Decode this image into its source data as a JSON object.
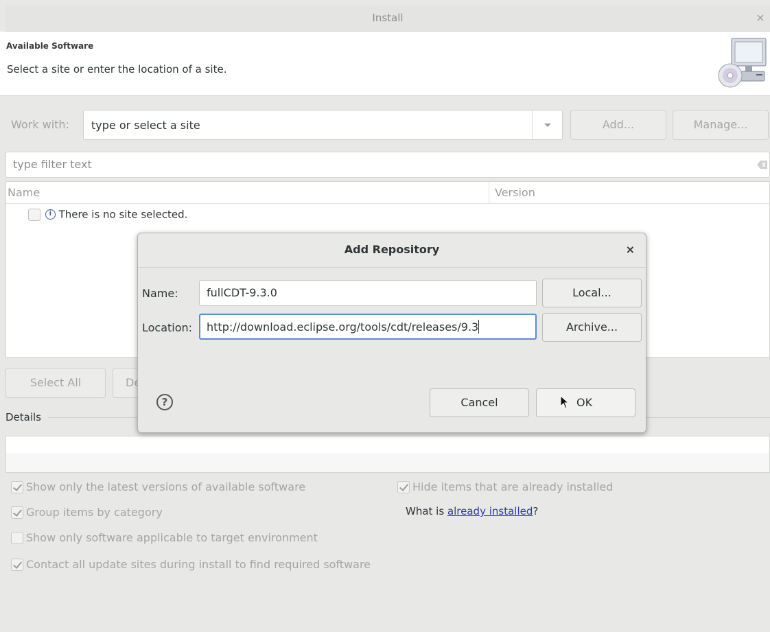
{
  "window": {
    "title": "Install",
    "close_glyph": "×"
  },
  "header": {
    "title": "Available Software",
    "description": "Select a site or enter the location of a site."
  },
  "work_with": {
    "label": "Work with:",
    "value": "type or select a site",
    "add_label": "Add...",
    "manage_label": "Manage..."
  },
  "filter": {
    "placeholder": "type filter text"
  },
  "table": {
    "columns": [
      "Name",
      "Version"
    ],
    "rows": [
      {
        "label": "There is no site selected."
      }
    ]
  },
  "buttons": {
    "select_all": "Select All",
    "deselect_all_partial": "De"
  },
  "details": {
    "label": "Details"
  },
  "options": {
    "latest_versions": {
      "label": "Show only the latest versions of available software",
      "checked": true
    },
    "group_by_category": {
      "label": "Group items by category",
      "checked": true
    },
    "applicable_only": {
      "label": "Show only software applicable to target environment",
      "checked": false
    },
    "contact_all_sites": {
      "label": "Contact all update sites during install to find required software",
      "checked": true
    },
    "hide_installed": {
      "label": "Hide items that are already installed",
      "checked": true
    },
    "what_is_prefix": "What is ",
    "already_installed_link": "already installed",
    "what_is_suffix": "?"
  },
  "dialog": {
    "title": "Add Repository",
    "close_glyph": "×",
    "name_label": "Name:",
    "name_value": "fullCDT-9.3.0",
    "location_label": "Location:",
    "location_value": "http://download.eclipse.org/tools/cdt/releases/9.3",
    "local_button": "Local...",
    "archive_button": "Archive...",
    "help_glyph": "?",
    "cancel_button": "Cancel",
    "ok_button": "OK"
  },
  "icons": {
    "wizard": "install-software-icon",
    "help": "help-icon",
    "info": "info-icon",
    "clear": "clear-filter-icon"
  },
  "colors": {
    "link": "#2a3ab5",
    "focus_ring": "#5c8bd0"
  }
}
